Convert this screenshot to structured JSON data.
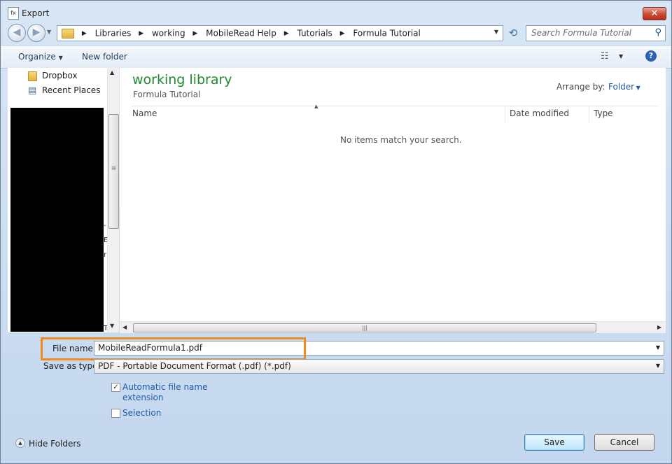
{
  "window": {
    "title": "Export",
    "close_glyph": "✕"
  },
  "nav": {
    "back_glyph": "◀",
    "forward_glyph": "▶"
  },
  "breadcrumb": [
    "Libraries",
    "working",
    "MobileRead Help",
    "Tutorials",
    "Formula Tutorial"
  ],
  "search": {
    "placeholder": "Search Formula Tutorial"
  },
  "toolbar": {
    "organize_label": "Organize",
    "new_folder_label": "New folder",
    "help_glyph": "?"
  },
  "navpane": {
    "items": [
      {
        "label": "Dropbox"
      },
      {
        "label": "Recent Places"
      }
    ]
  },
  "library": {
    "title": "working library",
    "subtitle": "Formula Tutorial",
    "arrange_label": "Arrange by:",
    "arrange_value": "Folder"
  },
  "columns": [
    "Name",
    "Date modified",
    "Type"
  ],
  "empty_message": "No items match your search.",
  "form": {
    "file_name_label": "File name:",
    "file_name_value": "MobileReadFormula1.pdf",
    "save_type_label": "Save as type:",
    "save_type_value": "PDF - Portable Document Format (.pdf) (*.pdf)",
    "auto_ext_label_1": "Automatic file name",
    "auto_ext_label_2": "extension",
    "auto_ext_checked": true,
    "selection_label": "Selection",
    "selection_checked": false
  },
  "footer": {
    "hide_folders_label": "Hide Folders",
    "save_label": "Save",
    "cancel_label": "Cancel"
  },
  "colors": {
    "highlight": "#f08a18",
    "library_title": "#1e8a2e",
    "link": "#1e5aa8"
  }
}
